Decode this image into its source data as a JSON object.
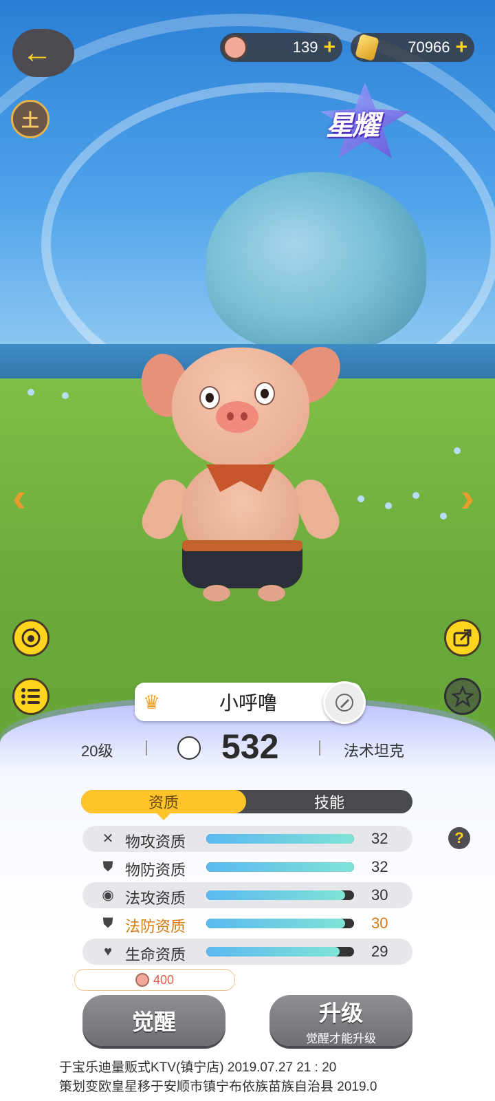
{
  "resources": {
    "pig_coins": "139",
    "gold": "70966",
    "plus": "+"
  },
  "top": {
    "back_icon": "←",
    "element_badge": "土",
    "star_badge": "星耀"
  },
  "nav": {
    "prev": "‹",
    "next": "›"
  },
  "pet": {
    "name": "小呼噜",
    "level": "20级",
    "power": "532",
    "role": "法术坦克"
  },
  "tabs": [
    "资质",
    "技能"
  ],
  "stats": [
    {
      "icon": "swords-icon",
      "glyph": "✕",
      "label": "物攻资质",
      "value": "32",
      "fill": 1.0,
      "highlight": false
    },
    {
      "icon": "shield-icon",
      "glyph": "⛊",
      "label": "物防资质",
      "value": "32",
      "fill": 1.0,
      "highlight": false
    },
    {
      "icon": "magic-orb-icon",
      "glyph": "◉",
      "label": "法攻资质",
      "value": "30",
      "fill": 0.94,
      "highlight": false
    },
    {
      "icon": "magic-shield-icon",
      "glyph": "⛊",
      "label": "法防资质",
      "value": "30",
      "fill": 0.94,
      "highlight": true
    },
    {
      "icon": "heart-icon",
      "glyph": "♥",
      "label": "生命资质",
      "value": "29",
      "fill": 0.9,
      "highlight": false
    }
  ],
  "help": "?",
  "cost": "400",
  "buttons": {
    "awaken": "觉醒",
    "upgrade": "升级",
    "upgrade_note": "觉醒才能升级"
  },
  "ticker": [
    "于宝乐迪量贩式KTV(镇宁店)  2019.07.27    21 : 20",
    "策划变欧皇星移于安顺市镇宁布依族苗族自治县 2019.0"
  ]
}
